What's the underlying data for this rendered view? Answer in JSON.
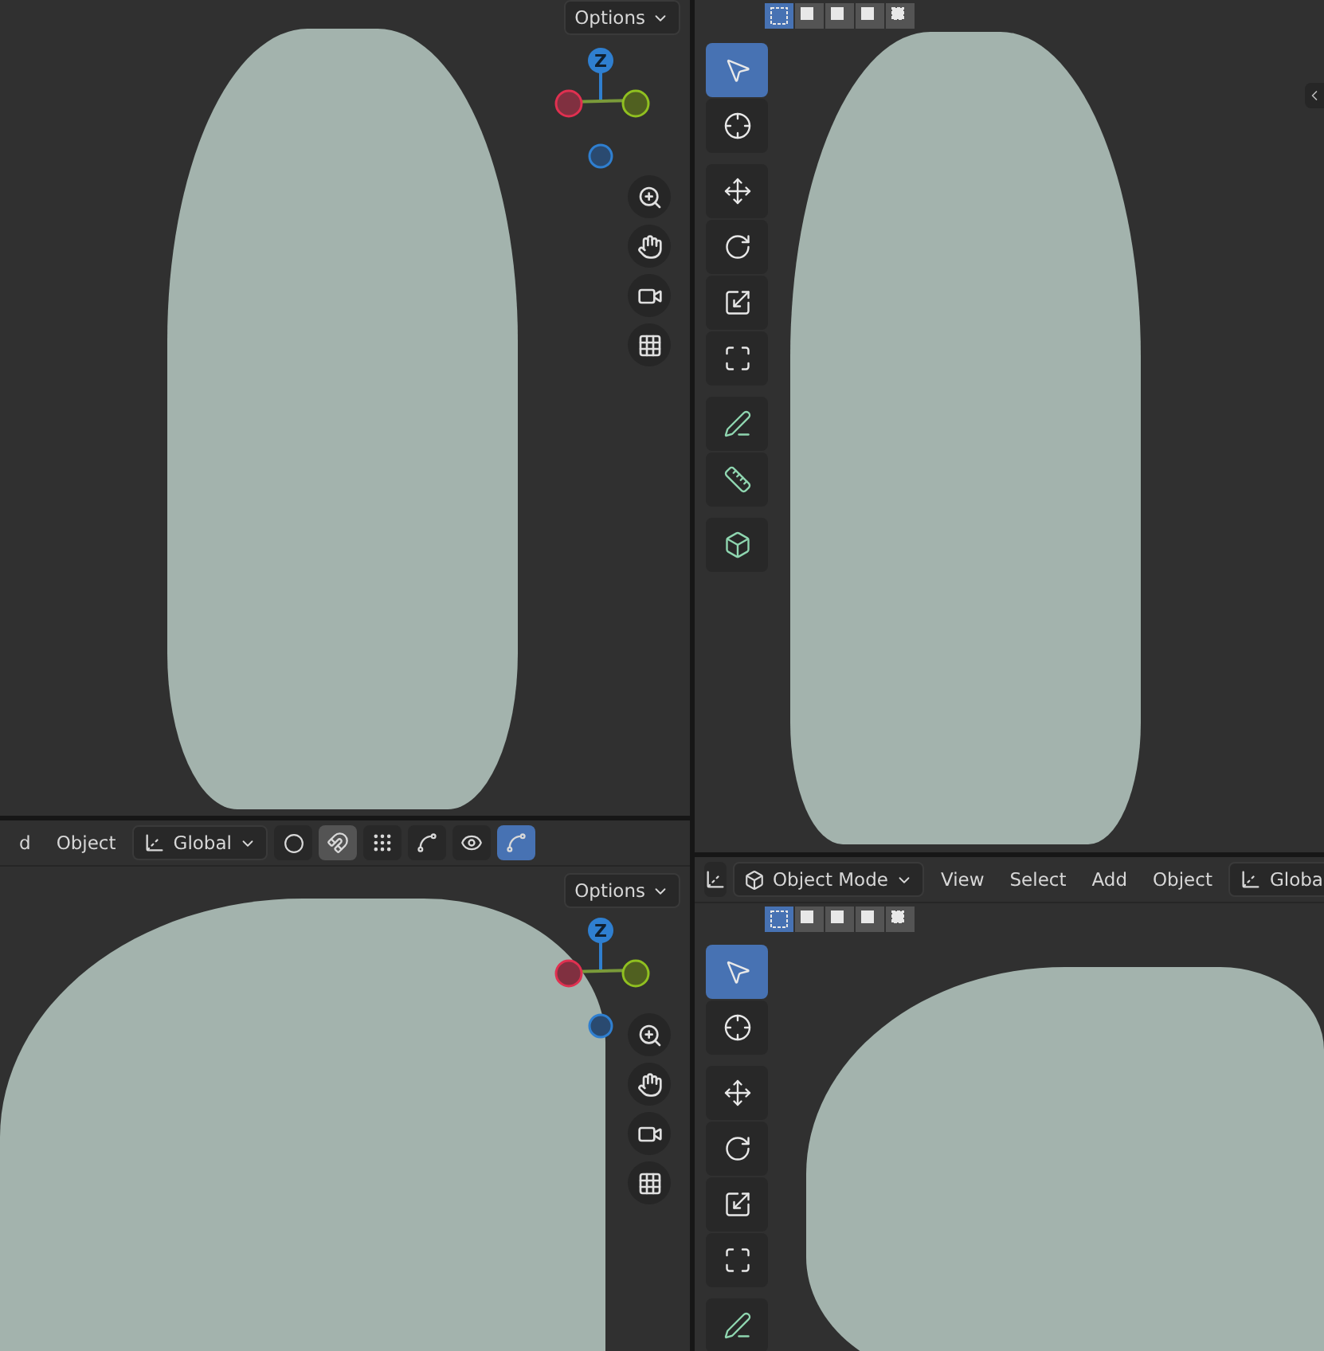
{
  "top_left": {
    "options_label": "Options",
    "axis_label": "Z"
  },
  "top_right": {
    "select_modes": [
      {
        "selected": true
      },
      {
        "selected": false
      },
      {
        "selected": false
      },
      {
        "selected": false
      },
      {
        "selected": false
      }
    ],
    "tool_groups": [
      {
        "tools": [
          {
            "kind": "select",
            "selected": true
          },
          {
            "kind": "cursor",
            "selected": false
          }
        ]
      },
      {
        "tools": [
          {
            "kind": "move",
            "selected": false
          },
          {
            "kind": "rotate",
            "selected": false
          },
          {
            "kind": "scale",
            "selected": false
          },
          {
            "kind": "transform",
            "selected": false
          }
        ]
      },
      {
        "tools": [
          {
            "kind": "annotate",
            "selected": false
          },
          {
            "kind": "measure",
            "selected": false
          }
        ]
      },
      {
        "tools": [
          {
            "kind": "add_cube",
            "selected": false
          }
        ]
      }
    ]
  },
  "bottom_left": {
    "header": {
      "menus": [
        "d",
        "Object"
      ],
      "orientation": "Global",
      "snap": {
        "on": true
      },
      "proportional": {
        "on": false
      },
      "gizmos": {
        "on": true
      }
    },
    "options_label": "Options",
    "axis_label": "Z"
  },
  "bottom_right": {
    "header": {
      "mode": "Object Mode",
      "menus": [
        "View",
        "Select",
        "Add",
        "Object"
      ],
      "orientation": "Globa"
    },
    "select_modes": [
      {
        "selected": true
      },
      {
        "selected": false
      },
      {
        "selected": false
      },
      {
        "selected": false
      },
      {
        "selected": false
      }
    ],
    "tool_groups": [
      {
        "tools": [
          {
            "kind": "select",
            "selected": true
          },
          {
            "kind": "cursor",
            "selected": false
          }
        ]
      },
      {
        "tools": [
          {
            "kind": "move",
            "selected": false
          },
          {
            "kind": "rotate",
            "selected": false
          },
          {
            "kind": "scale",
            "selected": false
          },
          {
            "kind": "transform",
            "selected": false
          }
        ]
      },
      {
        "tools": [
          {
            "kind": "annotate",
            "selected": false
          }
        ]
      }
    ]
  }
}
